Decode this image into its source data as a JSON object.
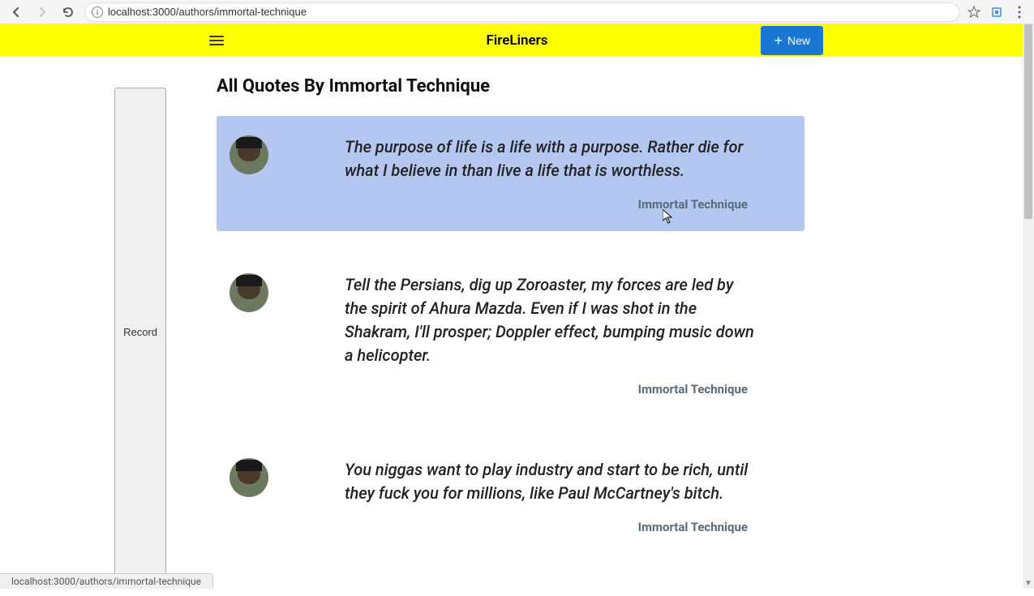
{
  "browser": {
    "url": "localhost:3000/authors/immortal-technique",
    "status_url": "localhost:3000/authors/immortal-technique"
  },
  "header": {
    "brand": "FireLiners",
    "new_button": "New"
  },
  "sidebar": {
    "record_label": "Record"
  },
  "page": {
    "title": "All Quotes By Immortal Technique"
  },
  "quotes": [
    {
      "text": "The purpose of life is a life with a purpose. Rather die for what I believe in than live a life that is worthless.",
      "author": "Immortal Technique",
      "highlighted": true
    },
    {
      "text": "Tell the Persians, dig up Zoroaster, my forces are led by the spirit of Ahura Mazda. Even if I was shot in the Shakram, I'll prosper; Doppler effect, bumping music down a helicopter.",
      "author": "Immortal Technique",
      "highlighted": false
    },
    {
      "text": "You niggas want to play industry and start to be rich, until they fuck you for millions, like Paul McCartney's bitch.",
      "author": "Immortal Technique",
      "highlighted": false
    }
  ]
}
